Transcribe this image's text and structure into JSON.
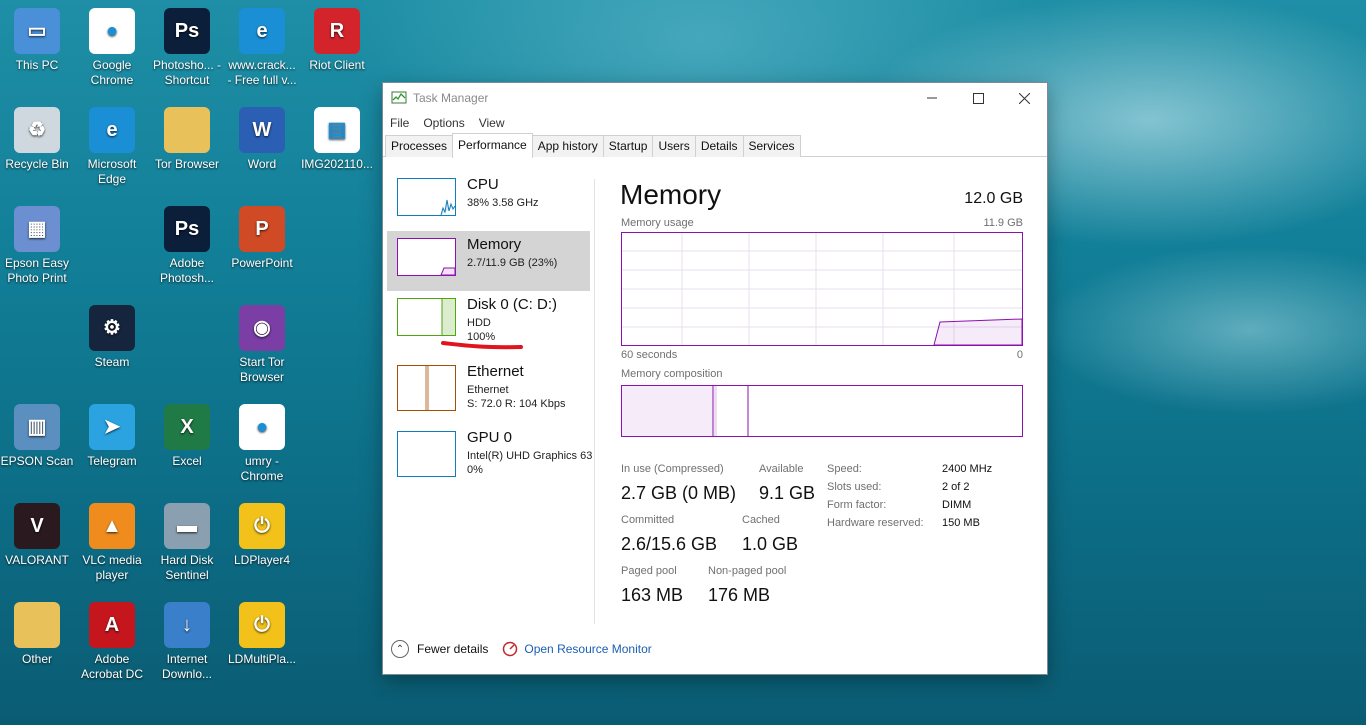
{
  "desktop": {
    "icons": [
      {
        "label": "This PC"
      },
      {
        "label": "Google Chrome"
      },
      {
        "label": "Photosho... - Shortcut"
      },
      {
        "label": "www.crack... - Free full v..."
      },
      {
        "label": "Riot Client"
      },
      {
        "label": "Recycle Bin"
      },
      {
        "label": "Microsoft Edge"
      },
      {
        "label": "Tor Browser"
      },
      {
        "label": "Word"
      },
      {
        "label": "IMG202110..."
      },
      {
        "label": "Epson Easy Photo Print"
      },
      {
        "label": "Adobe Photosh..."
      },
      {
        "label": "PowerPoint"
      },
      {
        "label": "Steam"
      },
      {
        "label": "Start Tor Browser"
      },
      {
        "label": "EPSON Scan"
      },
      {
        "label": "Telegram"
      },
      {
        "label": "Excel"
      },
      {
        "label": "umry - Chrome"
      },
      {
        "label": "VALORANT"
      },
      {
        "label": "VLC media player"
      },
      {
        "label": "Hard Disk Sentinel"
      },
      {
        "label": "LDPlayer4"
      },
      {
        "label": "Other"
      },
      {
        "label": "Adobe Acrobat DC"
      },
      {
        "label": "Internet Downlo..."
      },
      {
        "label": "LDMultiPla..."
      }
    ]
  },
  "window": {
    "title": "Task Manager",
    "menu": [
      "File",
      "Options",
      "View"
    ],
    "tabs": [
      "Processes",
      "Performance",
      "App history",
      "Startup",
      "Users",
      "Details",
      "Services"
    ],
    "active_tab": "Performance"
  },
  "resources": [
    {
      "name": "CPU",
      "line1": "38%  3.58 GHz",
      "line2": "",
      "color": "#117dbb"
    },
    {
      "name": "Memory",
      "line1": "2.7/11.9 GB (23%)",
      "line2": "",
      "color": "#8b12ae"
    },
    {
      "name": "Disk 0 (C: D:)",
      "line1": "HDD",
      "line2": "100%",
      "color": "#4da60c"
    },
    {
      "name": "Ethernet",
      "line1": "Ethernet",
      "line2": "S: 72.0  R: 104 Kbps",
      "color": "#a74f01"
    },
    {
      "name": "GPU 0",
      "line1": "Intel(R) UHD Graphics 63",
      "line2": "0%",
      "color": "#117dbb"
    }
  ],
  "memory": {
    "title": "Memory",
    "total": "12.0 GB",
    "usage_label": "Memory usage",
    "usage_max": "11.9 GB",
    "time_left": "60 seconds",
    "time_right": "0",
    "composition_label": "Memory composition",
    "in_use_label": "In use (Compressed)",
    "in_use_value": "2.7 GB (0 MB)",
    "available_label": "Available",
    "available_value": "9.1 GB",
    "committed_label": "Committed",
    "committed_value": "2.6/15.6 GB",
    "cached_label": "Cached",
    "cached_value": "1.0 GB",
    "paged_label": "Paged pool",
    "paged_value": "163 MB",
    "nonpaged_label": "Non-paged pool",
    "nonpaged_value": "176 MB",
    "specs": [
      {
        "label": "Speed:",
        "value": "2400 MHz"
      },
      {
        "label": "Slots used:",
        "value": "2 of 2"
      },
      {
        "label": "Form factor:",
        "value": "DIMM"
      },
      {
        "label": "Hardware reserved:",
        "value": "150 MB"
      }
    ],
    "accent": "#8b12ae"
  },
  "footer": {
    "fewer_details": "Fewer details",
    "open_resource_monitor": "Open Resource Monitor"
  }
}
